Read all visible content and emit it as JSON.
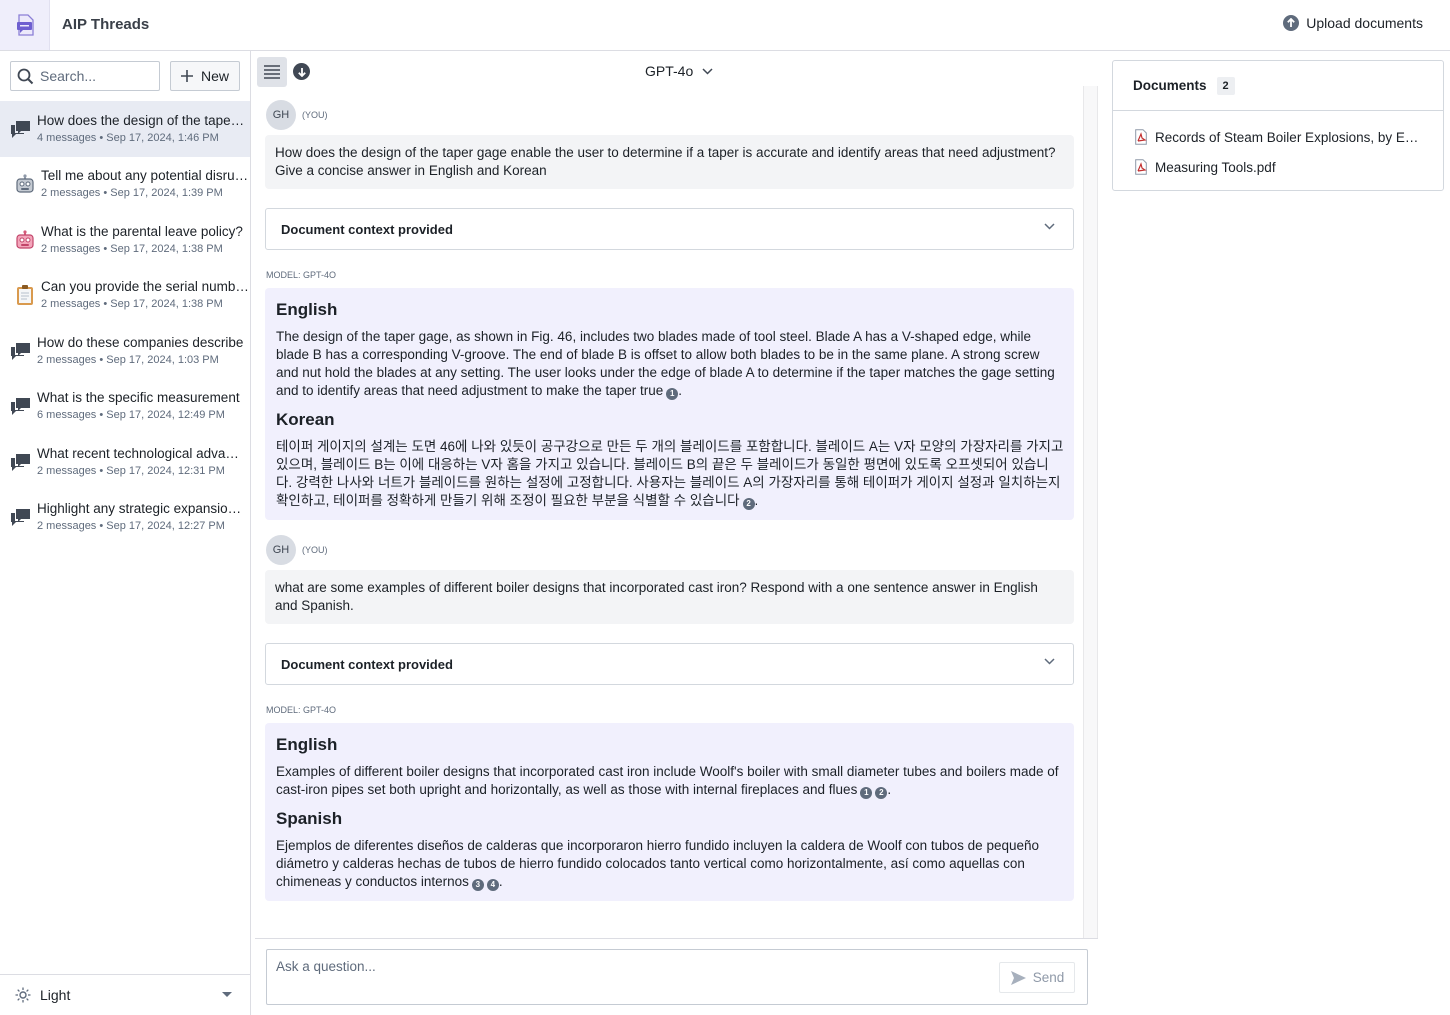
{
  "app": {
    "title": "AIP Threads",
    "upload_label": "Upload documents"
  },
  "sidebar": {
    "search_placeholder": "Search...",
    "new_label": "New",
    "threads": [
      {
        "title": "How does the design of the taper gage enable the user to determine if a taper is accurate",
        "meta": "4 messages • Sep 17, 2024, 1:46 PM",
        "icon": "chat-bubbles-icon",
        "active": true
      },
      {
        "title": "Tell me about any potential disruptions",
        "meta": "2 messages • Sep 17, 2024, 1:39 PM",
        "icon": "robot-gray-icon",
        "active": false
      },
      {
        "title": "What is the parental leave policy?",
        "meta": "2 messages • Sep 17, 2024, 1:38 PM",
        "icon": "robot-pink-icon",
        "active": false
      },
      {
        "title": "Can you provide the serial numbers",
        "meta": "2 messages • Sep 17, 2024, 1:38 PM",
        "icon": "clipboard-icon",
        "active": false
      },
      {
        "title": "How do these companies describe",
        "meta": "2 messages • Sep 17, 2024, 1:03 PM",
        "icon": "chat-bubbles-icon",
        "active": false
      },
      {
        "title": "What is the specific measurement",
        "meta": "6 messages • Sep 17, 2024, 12:49 PM",
        "icon": "chat-bubbles-icon",
        "active": false
      },
      {
        "title": "What recent technological advancements",
        "meta": "2 messages • Sep 17, 2024, 12:31 PM",
        "icon": "chat-bubbles-icon",
        "active": false
      },
      {
        "title": "Highlight any strategic expansion plans",
        "meta": "2 messages • Sep 17, 2024, 12:27 PM",
        "icon": "chat-bubbles-icon",
        "active": false
      }
    ],
    "theme_label": "Light"
  },
  "toolbar": {
    "model": "GPT-4o"
  },
  "conversation": [
    {
      "user_initials": "GH",
      "you_label": "(YOU)",
      "question": "How does the design of the taper gage enable the user to determine if a taper is accurate and identify areas that need adjustment? Give a concise answer in English and Korean",
      "context_label": "Document context provided",
      "model_label": "MODEL: GPT-4O",
      "sections": [
        {
          "heading": "English",
          "text": "The design of the taper gage, as shown in Fig. 46, includes two blades made of tool steel. Blade A has a V-shaped edge, while blade B has a corresponding V-groove. The end of blade B is offset to allow both blades to be in the same plane. A strong screw and nut hold the blades at any setting. The user looks under the edge of blade A to determine if the taper matches the gage setting and to identify areas that need adjustment to make the taper true",
          "citations": [
            "1"
          ]
        },
        {
          "heading": "Korean",
          "text": "테이퍼 게이지의 설계는 도면 46에 나와 있듯이 공구강으로 만든 두 개의 블레이드를 포함합니다. 블레이드 A는 V자 모양의 가장자리를 가지고 있으며, 블레이드 B는 이에 대응하는 V자 홈을 가지고 있습니다. 블레이드 B의 끝은 두 블레이드가 동일한 평면에 있도록 오프셋되어 있습니다. 강력한 나사와 너트가 블레이드를 원하는 설정에 고정합니다. 사용자는 블레이드 A의 가장자리를 통해 테이퍼가 게이지 설정과 일치하는지 확인하고, 테이퍼를 정확하게 만들기 위해 조정이 필요한 부분을 식별할 수 있습니다",
          "citations": [
            "2"
          ]
        }
      ]
    },
    {
      "user_initials": "GH",
      "you_label": "(YOU)",
      "question": "what are some examples of different boiler designs that incorporated cast iron? Respond with a one sentence answer in English and Spanish.",
      "context_label": "Document context provided",
      "model_label": "MODEL: GPT-4O",
      "sections": [
        {
          "heading": "English",
          "text": "Examples of different boiler designs that incorporated cast iron include Woolf's boiler with small diameter tubes and boilers made of cast-iron pipes set both upright and horizontally, as well as those with internal fireplaces and flues",
          "citations": [
            "1",
            "2"
          ]
        },
        {
          "heading": "Spanish",
          "text": "Ejemplos de diferentes diseños de calderas que incorporaron hierro fundido incluyen la caldera de Woolf con tubos de pequeño diámetro y calderas hechas de tubos de hierro fundido colocados tanto vertical como horizontalmente, así como aquellas con chimeneas y conductos internos",
          "citations": [
            "3",
            "4"
          ]
        }
      ]
    }
  ],
  "composer": {
    "placeholder": "Ask a question...",
    "send_label": "Send"
  },
  "documents": {
    "title": "Documents",
    "count": "2",
    "items": [
      {
        "name": "Records of Steam Boiler Explosions, by Edward Bindon Marten.pdf",
        "icon": "pdf-icon"
      },
      {
        "name": "Measuring Tools.pdf",
        "icon": "pdf-icon"
      }
    ]
  },
  "colors": {
    "accent_logo_bg": "#efeefb",
    "active_thread_bg": "#e8ebf3",
    "answer_bg": "#f1f0fd",
    "question_bg": "#f3f4f6",
    "pdf_red": "#c23030"
  }
}
